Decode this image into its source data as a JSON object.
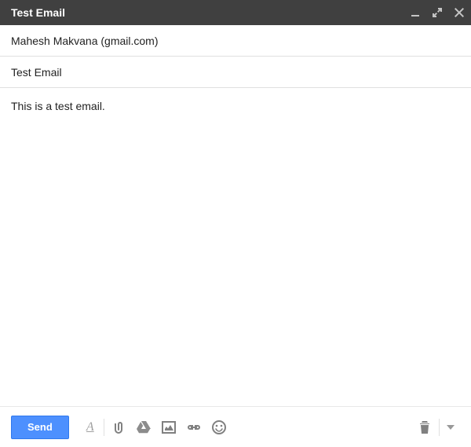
{
  "header": {
    "title": "Test Email"
  },
  "to": {
    "value": "Mahesh Makvana (gmail.com)"
  },
  "subject": {
    "value": "Test Email"
  },
  "body": {
    "text": "This is a test email."
  },
  "footer": {
    "send_label": "Send",
    "format_glyph": "A"
  }
}
